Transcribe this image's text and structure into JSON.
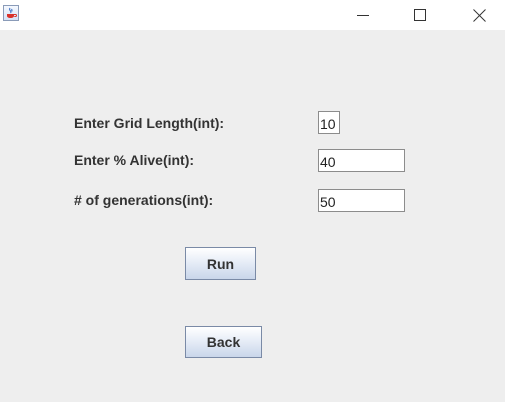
{
  "titlebar": {
    "icons": {
      "app": "java-cup-icon",
      "minimize": "minimize-icon",
      "maximize": "maximize-icon",
      "close": "close-icon"
    }
  },
  "form": {
    "grid_length_label": "Enter Grid Length(int):",
    "grid_length_value": "10",
    "alive_label": "Enter % Alive(int):",
    "alive_value": "40",
    "generations_label": "# of generations(int):",
    "generations_value": "50"
  },
  "buttons": {
    "run_label": "Run",
    "back_label": "Back"
  }
}
